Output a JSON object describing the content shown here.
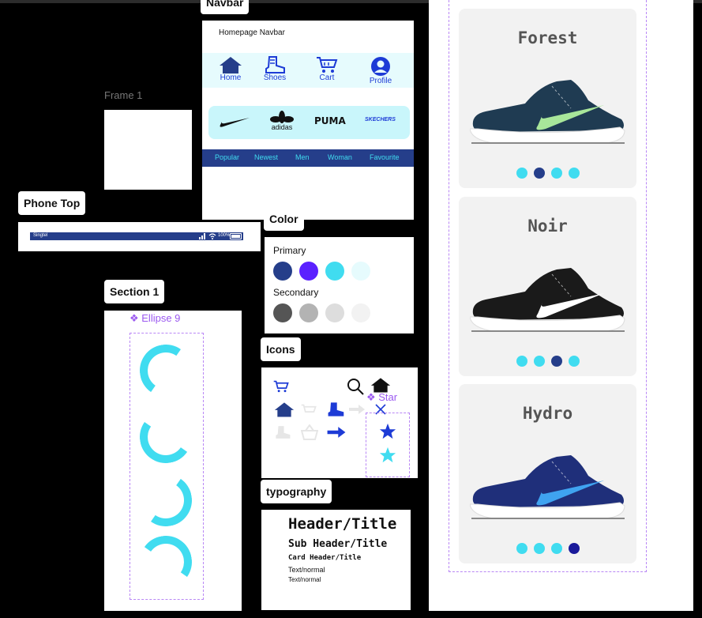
{
  "labels": {
    "navbar": "Navbar",
    "frame1": "Frame 1",
    "phone_top": "Phone Top",
    "color": "Color",
    "section1": "Section 1",
    "ellipse": "❖ Ellipse 9",
    "icons": "Icons",
    "star": "❖ Star",
    "typography": "typography"
  },
  "navbar_panel": {
    "title": "Homepage Navbar",
    "items": [
      {
        "label": "Home",
        "icon": "home-icon"
      },
      {
        "label": "Shoes",
        "icon": "boot-icon"
      },
      {
        "label": "Cart",
        "icon": "cart-icon"
      },
      {
        "label": "Profile",
        "icon": "profile-icon"
      }
    ],
    "brands": [
      "adidas",
      "PUMA",
      "SKECHERS"
    ],
    "categories": [
      "Popular",
      "Newest",
      "Men",
      "Woman",
      "Favourite"
    ]
  },
  "phone_top": {
    "carrier": "Singtel",
    "battery": "100%"
  },
  "color_panel": {
    "primary_label": "Primary",
    "primary": [
      "#253e8a",
      "#5b21ff",
      "#40dcf0",
      "#e6fbfd"
    ],
    "secondary_label": "Secondary",
    "secondary": [
      "#555555",
      "#b3b3b3",
      "#dddddd",
      "#f2f2f2"
    ]
  },
  "typography": {
    "header": "Header/Title",
    "sub_header": "Sub Header/Title",
    "card_header": "Card Header/Title",
    "text1": "Text/normal",
    "text2": "Text/normal"
  },
  "products": [
    {
      "name": "Forest",
      "shoe_color": "#1f3b52",
      "swoosh": "#a8e69a",
      "dots": [
        "#40dcf0",
        "#253e8a",
        "#40dcf0",
        "#40dcf0"
      ]
    },
    {
      "name": "Noir",
      "shoe_color": "#1a1a1a",
      "swoosh": "#ffffff",
      "dots": [
        "#40dcf0",
        "#40dcf0",
        "#253e8a",
        "#40dcf0"
      ]
    },
    {
      "name": "Hydro",
      "shoe_color": "#1f2f7a",
      "swoosh": "#3fa3f0",
      "dots": [
        "#40dcf0",
        "#40dcf0",
        "#40dcf0",
        "#1a1a9a"
      ]
    }
  ]
}
